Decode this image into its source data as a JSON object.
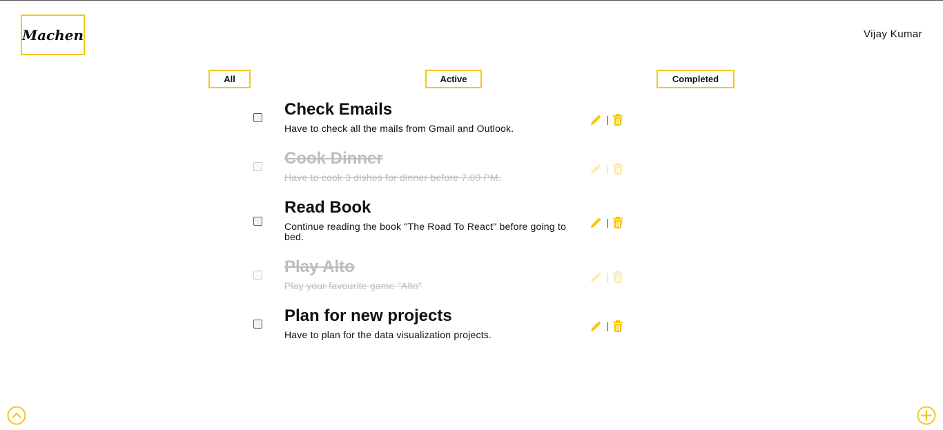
{
  "app": {
    "logo": "Machen",
    "user_name": "Vijay Kumar"
  },
  "filters": [
    {
      "label": "All"
    },
    {
      "label": "Active"
    },
    {
      "label": "Completed"
    }
  ],
  "todos": [
    {
      "title": "Check Emails",
      "description": "Have to check all the mails from Gmail and Outlook.",
      "completed": false
    },
    {
      "title": "Cook Dinner",
      "description": "Have to cook 3 dishes for dinner before 7.00 PM.",
      "completed": true
    },
    {
      "title": "Read Book",
      "description": "Continue reading the book \"The Road To React\" before going to bed.",
      "completed": false
    },
    {
      "title": "Play Alto",
      "description": "Play your favourite game \"Alto\"",
      "completed": true
    },
    {
      "title": "Plan for new projects",
      "description": "Have to plan for the data visualization projects.",
      "completed": false
    }
  ],
  "icons": {
    "edit": "pencil-icon",
    "delete": "trash-icon",
    "scroll_top": "chevron-up-circle-icon",
    "add": "plus-circle-icon"
  },
  "colors": {
    "accent": "#f5c816",
    "completed_text": "#bdbdbd"
  }
}
